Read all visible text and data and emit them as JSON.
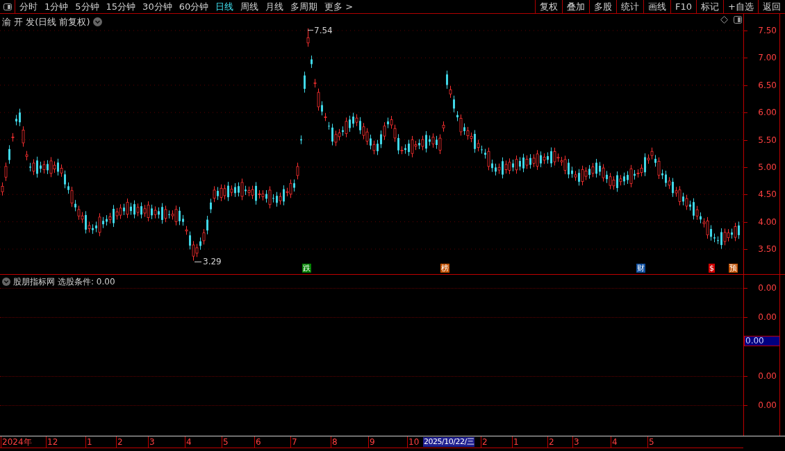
{
  "toolbar": {
    "periods": [
      {
        "label": "分时",
        "selected": false
      },
      {
        "label": "1分钟",
        "selected": false
      },
      {
        "label": "5分钟",
        "selected": false
      },
      {
        "label": "15分钟",
        "selected": false
      },
      {
        "label": "30分钟",
        "selected": false
      },
      {
        "label": "60分钟",
        "selected": false
      },
      {
        "label": "日线",
        "selected": true
      },
      {
        "label": "周线",
        "selected": false
      },
      {
        "label": "月线",
        "selected": false
      },
      {
        "label": "多周期",
        "selected": false
      },
      {
        "label": "更多 >",
        "selected": false
      }
    ],
    "buttons": [
      "复权",
      "叠加",
      "多股",
      "统计",
      "画线",
      "F10",
      "标记",
      "+自选",
      "返回"
    ]
  },
  "main_chart": {
    "title": "渝 开 发(日线 前复权)",
    "high_label": "7.54",
    "low_label": "3.29",
    "events": [
      {
        "label": "跌",
        "color": "#008000"
      },
      {
        "label": "榜",
        "color": "#c05000"
      },
      {
        "label": "财",
        "color": "#1050a0"
      },
      {
        "label": "$",
        "color": "#d00000"
      },
      {
        "label": "预",
        "color": "#c05000"
      }
    ],
    "price_axis": [
      "7.50",
      "7.00",
      "6.50",
      "6.00",
      "5.50",
      "5.00",
      "4.50",
      "4.00",
      "3.50"
    ]
  },
  "indicator_panel": {
    "name": "股朋指标网",
    "value": "选股条件: 0.00",
    "axis": [
      "0.00",
      "0.00",
      "0.00",
      "0.00"
    ],
    "cursor_value": "0.00"
  },
  "date_axis": {
    "labels": [
      "2024年",
      "12",
      "1",
      "2",
      "3",
      "4",
      "5",
      "6",
      "7",
      "8",
      "9",
      "10",
      "2",
      "1",
      "2",
      "3",
      "4",
      "5"
    ],
    "cursor_date": "2025/10/22/三"
  }
}
